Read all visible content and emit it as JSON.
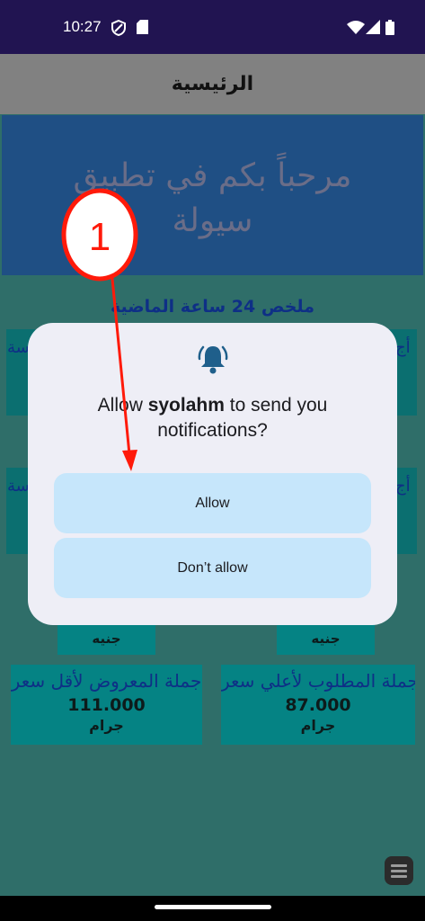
{
  "status_bar": {
    "time": "10:27",
    "icons": [
      "shield-icon",
      "sd-card-icon",
      "wifi-icon",
      "signal-icon",
      "battery-icon"
    ]
  },
  "app_bar": {
    "title": "الرئيسية"
  },
  "banner": {
    "line1": "مرحباً بكم في تطبيق",
    "line2": "سيولة"
  },
  "summary": {
    "title": "ملخص 24 ساعة الماضية"
  },
  "edge_texts": {
    "left_top": "سة",
    "right_top": "أج",
    "left_mid": "سة",
    "right_mid": "أج"
  },
  "unit_row": {
    "left": "جنيه",
    "right": "جنيه"
  },
  "cards": [
    {
      "title": "جملة المعروض لأقل سعر",
      "value": "111.000",
      "unit": "جرام"
    },
    {
      "title": "جملة المطلوب لأعلي سعر",
      "value": "87.000",
      "unit": "جرام"
    }
  ],
  "dialog": {
    "message_prefix": "Allow ",
    "app_name": "syolahm",
    "message_suffix": " to send you notifications?",
    "allow_label": "Allow",
    "deny_label": "Don’t allow"
  },
  "annotation": {
    "step": "1",
    "color": "#ff1a0a"
  },
  "colors": {
    "status_bar": "#211451",
    "app_bar": "#818181",
    "banner": "#1f4f84",
    "card": "#058384",
    "dialog_button": "#c6e6fb"
  }
}
